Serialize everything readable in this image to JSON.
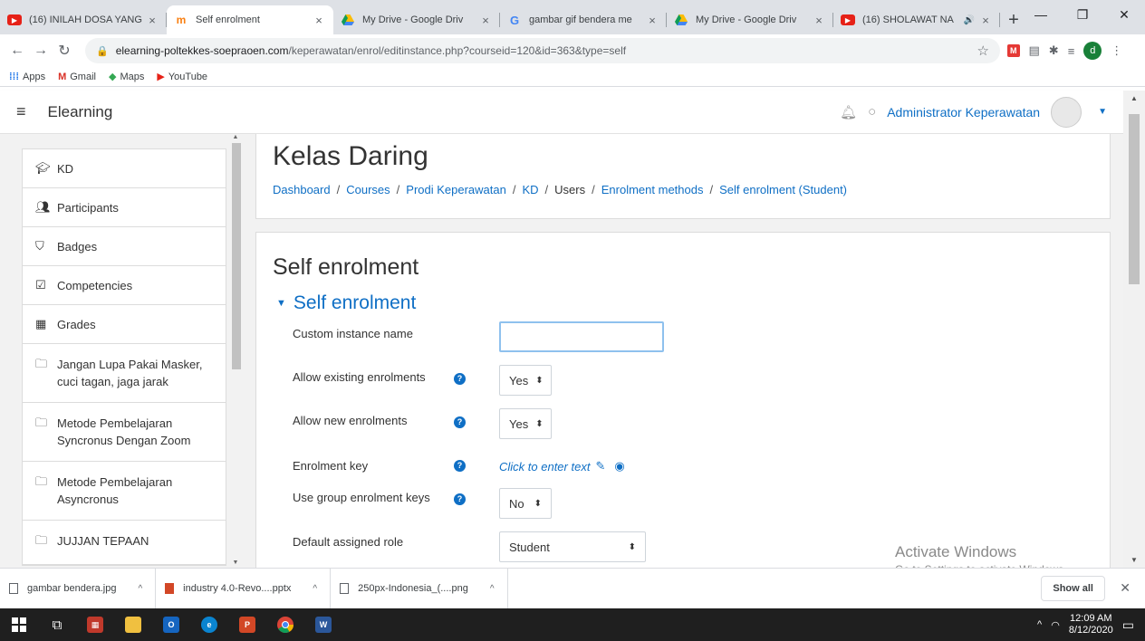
{
  "browser": {
    "tabs": [
      {
        "title": "(16) INILAH DOSA YANG",
        "icon": "youtube-icon",
        "active": false
      },
      {
        "title": "Self enrolment",
        "icon": "moodle-icon",
        "active": true
      },
      {
        "title": "My Drive - Google Driv",
        "icon": "drive-icon",
        "active": false
      },
      {
        "title": "gambar gif bendera me",
        "icon": "google-icon",
        "active": false
      },
      {
        "title": "My Drive - Google Driv",
        "icon": "drive-icon",
        "active": false
      },
      {
        "title": "(16) SHOLAWAT NA",
        "icon": "youtube-icon",
        "active": false
      }
    ],
    "url_host": "elearning-poltekkes-soepraoen.com",
    "url_path": "/keperawatan/enrol/editinstance.php?courseid=120&id=363&type=self",
    "profile_initial": "d",
    "bookmarks": [
      "Apps",
      "Gmail",
      "Maps",
      "YouTube"
    ]
  },
  "navbar": {
    "brand": "Elearning",
    "user_name": "Administrator Keperawatan"
  },
  "drawer": {
    "items": [
      {
        "label": "KD",
        "icon": "graduation-cap-icon"
      },
      {
        "label": "Participants",
        "icon": "users-icon"
      },
      {
        "label": "Badges",
        "icon": "shield-icon"
      },
      {
        "label": "Competencies",
        "icon": "checkbox-icon"
      },
      {
        "label": "Grades",
        "icon": "table-icon"
      },
      {
        "label": "Jangan Lupa Pakai Masker, cuci tagan, jaga jarak",
        "icon": "folder-icon"
      },
      {
        "label": "Metode Pembelajaran Syncronus Dengan Zoom",
        "icon": "folder-icon"
      },
      {
        "label": "Metode Pembelajaran Asyncronus",
        "icon": "folder-icon"
      },
      {
        "label": "JUJJAN TEPAAN",
        "icon": "folder-icon"
      }
    ]
  },
  "page": {
    "title": "Kelas Daring",
    "breadcrumb": [
      {
        "label": "Dashboard",
        "link": true
      },
      {
        "label": "Courses",
        "link": true
      },
      {
        "label": "Prodi Keperawatan",
        "link": true
      },
      {
        "label": "KD",
        "link": true
      },
      {
        "label": "Users",
        "link": false
      },
      {
        "label": "Enrolment methods",
        "link": true
      },
      {
        "label": "Self enrolment (Student)",
        "link": true
      }
    ]
  },
  "form": {
    "heading": "Self enrolment",
    "legend": "Self enrolment",
    "custom_instance_name": {
      "label": "Custom instance name",
      "value": ""
    },
    "allow_existing": {
      "label": "Allow existing enrolments",
      "value": "Yes"
    },
    "allow_new": {
      "label": "Allow new enrolments",
      "value": "Yes"
    },
    "enrolment_key": {
      "label": "Enrolment key",
      "placeholder": "Click to enter text"
    },
    "group_keys": {
      "label": "Use group enrolment keys",
      "value": "No"
    },
    "default_role": {
      "label": "Default assigned role",
      "value": "Student"
    }
  },
  "watermark": {
    "line1": "Activate Windows",
    "line2": "Go to Settings to activate Windows."
  },
  "downloads": {
    "items": [
      "gambar bendera.jpg",
      "industry 4.0-Revo....pptx",
      "250px-Indonesia_(....png"
    ],
    "show_all": "Show all"
  },
  "taskbar": {
    "time": "12:09 AM",
    "date": "8/12/2020"
  },
  "colors": {
    "link": "#0f6fc5",
    "help": "#0f6fc5"
  }
}
